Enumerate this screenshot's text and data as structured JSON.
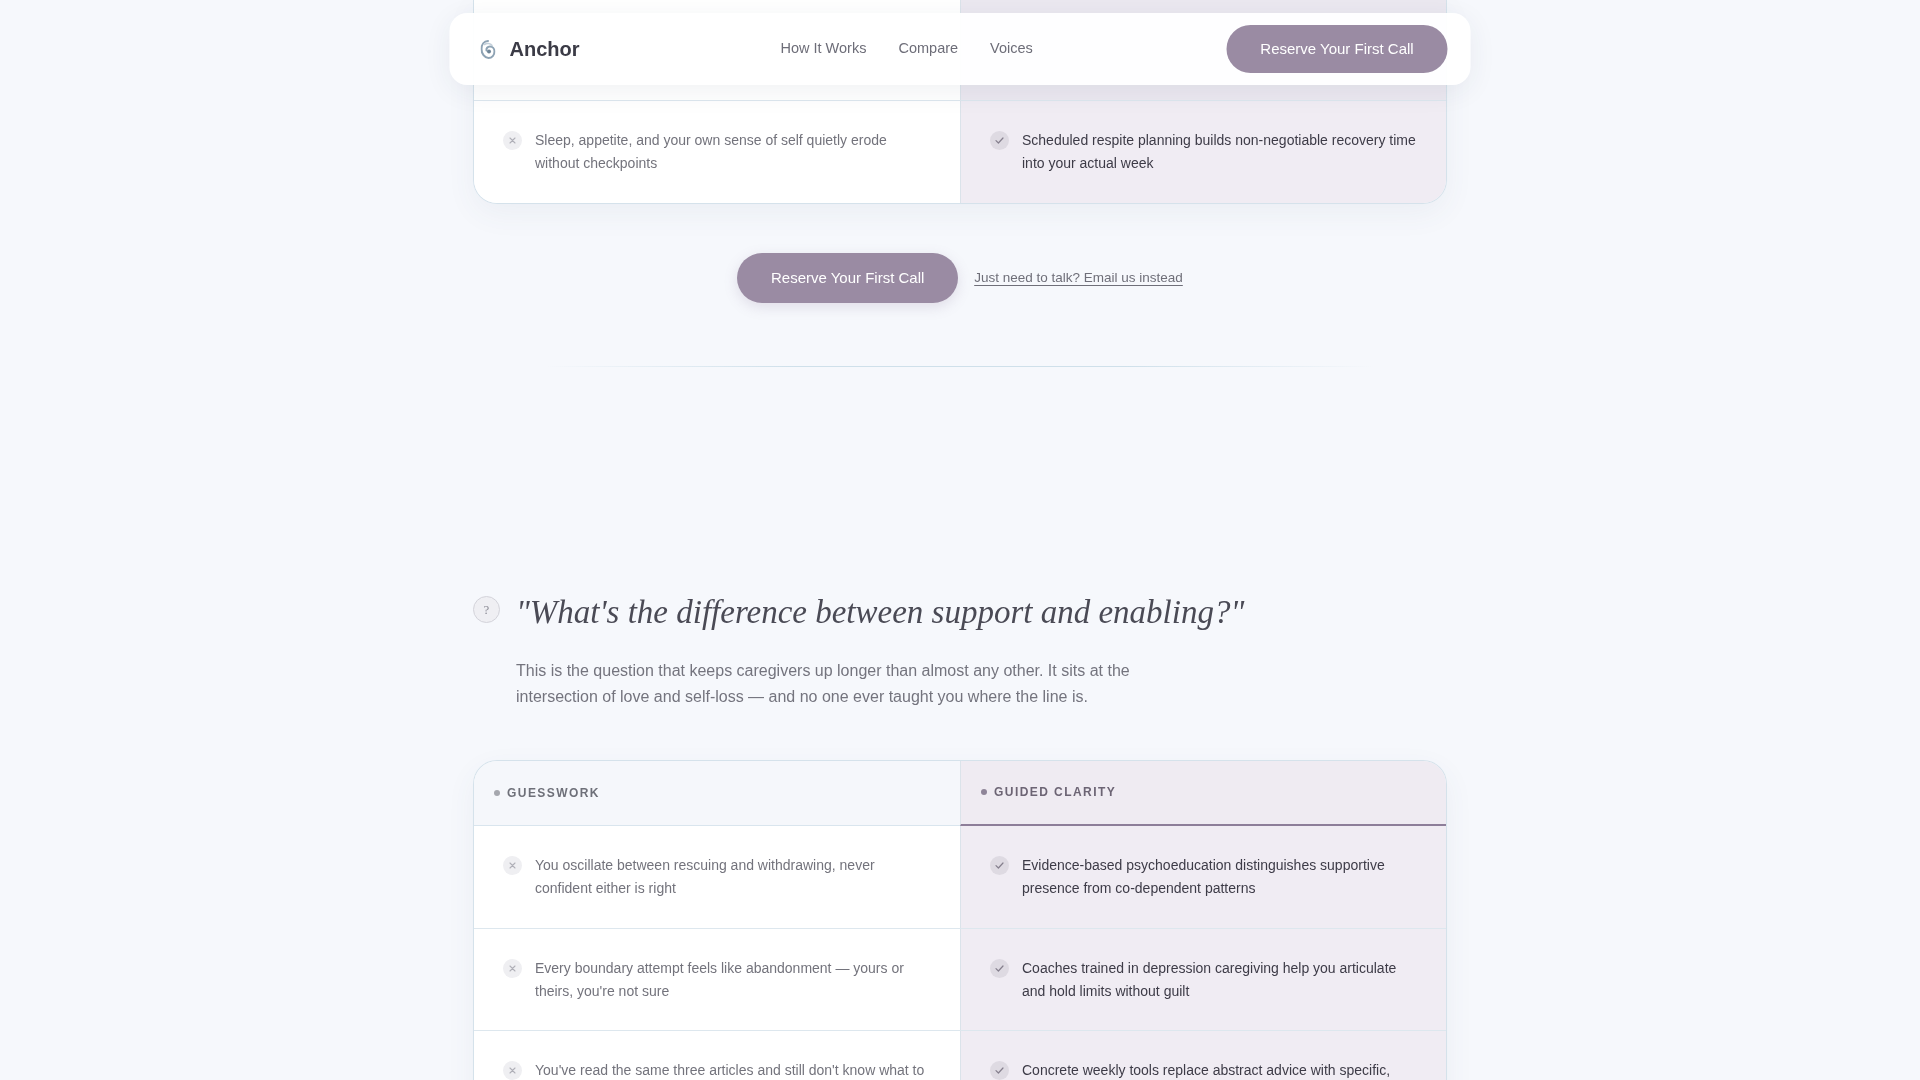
{
  "nav": {
    "brand": "Anchor",
    "links": [
      "How It Works",
      "Compare",
      "Voices"
    ],
    "button": "Reserve Your First Call"
  },
  "comparison_top": {
    "columns": [
      {
        "kind": "without"
      },
      {
        "kind": "with"
      }
    ],
    "rows": [
      [
        "Sleep, appetite, and your own sense of self quietly erode without checkpoints",
        "Scheduled respite planning builds non-negotiable recovery time into your actual week"
      ]
    ]
  },
  "cta": {
    "button": "Reserve Your First Call",
    "link": "Just need to talk? Email us instead"
  },
  "question": {
    "badge": "?",
    "title": "\"What's the difference between support and enabling?\"",
    "text": "This is the question that keeps caregivers up longer than almost any other. It sits at the intersection of love and self-loss — and no one ever taught you where the line is."
  },
  "comparison": {
    "columns": [
      {
        "label": "GUESSWORK",
        "kind": "without"
      },
      {
        "label": "GUIDED CLARITY",
        "kind": "with"
      }
    ],
    "rows": [
      [
        "You oscillate between rescuing and withdrawing, never confident either is right",
        "Evidence-based psychoeducation distinguishes supportive presence from co-dependent patterns"
      ],
      [
        "Every boundary attempt feels like abandonment — yours or theirs, you're not sure",
        "Coaches trained in depression caregiving help you articulate and hold limits without guilt"
      ],
      [
        "You've read the same three articles and still don't know what to",
        "Concrete weekly tools replace abstract advice with specific,"
      ]
    ]
  }
}
